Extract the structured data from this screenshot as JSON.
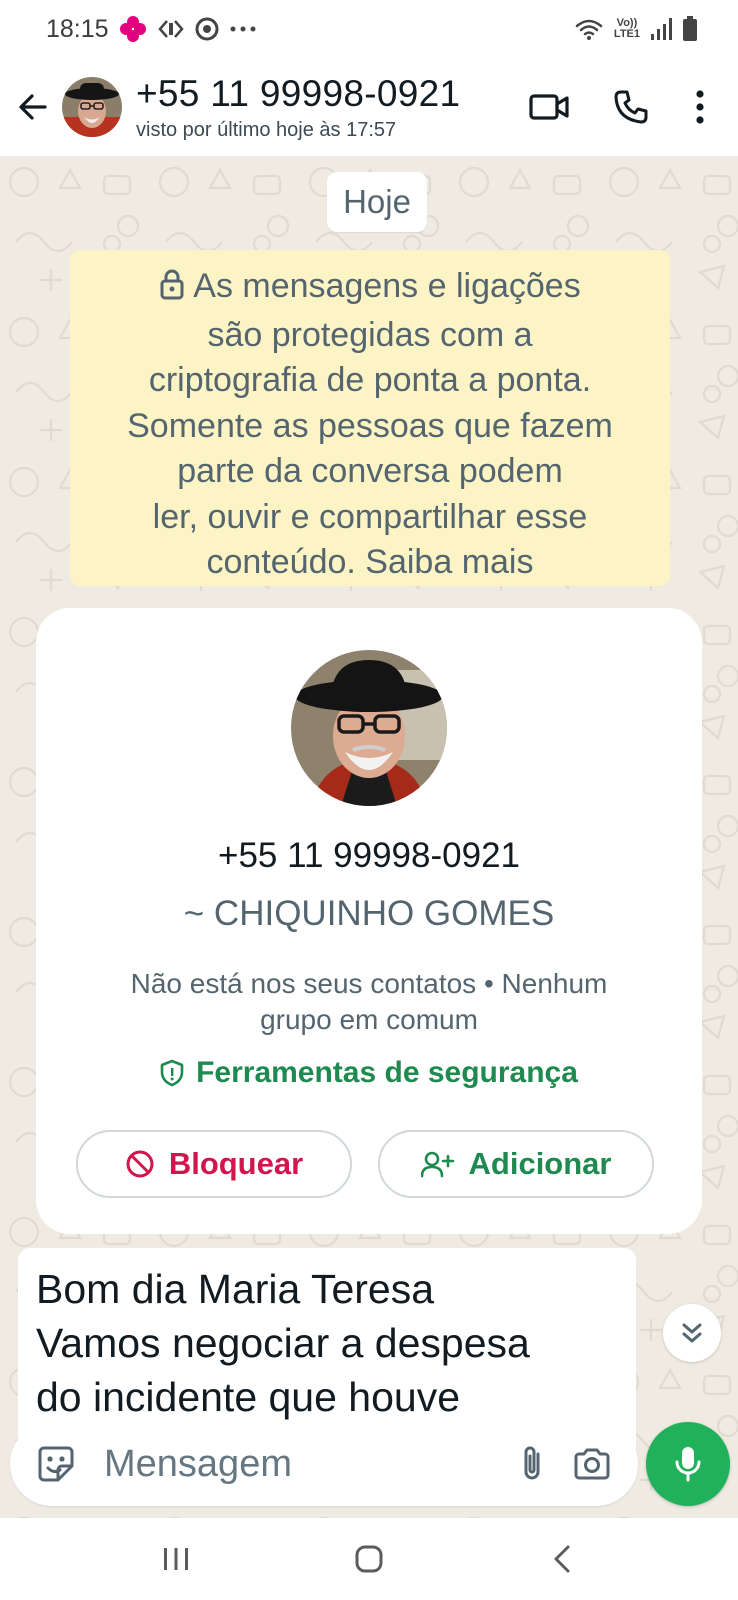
{
  "status_bar": {
    "time": "18:15",
    "icons": [
      "flower-notification-icon",
      "cast-icon",
      "chrome-icon",
      "more-dots-icon",
      "wifi-icon",
      "volte-icon",
      "signal-icon",
      "battery-icon"
    ],
    "network": {
      "line1": "Vo))",
      "line2": "LTE1"
    }
  },
  "header": {
    "title": "+55 11 99998-0921",
    "subtitle": "visto por último hoje às 17:57"
  },
  "chat": {
    "date_chip": "Hoje",
    "e2e_notice": {
      "lines": [
        "As mensagens e ligações",
        "são protegidas com a",
        "criptografia de ponta a ponta.",
        "Somente as pessoas que fazem",
        "parte da conversa podem",
        "ler, ouvir e compartilhar esse",
        "conteúdo. Saiba mais"
      ]
    },
    "contact_card": {
      "phone": "+55 11 99998-0921",
      "name": "~ CHIQUINHO GOMES",
      "info_line1": "Não está nos seus contatos • Nenhum",
      "info_line2": "grupo em comum",
      "safety_tools": "Ferramentas de segurança",
      "block_label": "Bloquear",
      "add_label": "Adicionar"
    },
    "message": {
      "line1": "Bom dia Maria Teresa",
      "line2": "Vamos negociar a despesa",
      "line3": "do incidente que houve"
    }
  },
  "composer": {
    "placeholder": "Mensagem"
  },
  "colors": {
    "accent_green": "#21b15b",
    "tools_green": "#1f8a50",
    "block_red": "#d2164d",
    "notice_bg": "#fdf4c5",
    "wallpaper_bg": "#efeae2"
  }
}
